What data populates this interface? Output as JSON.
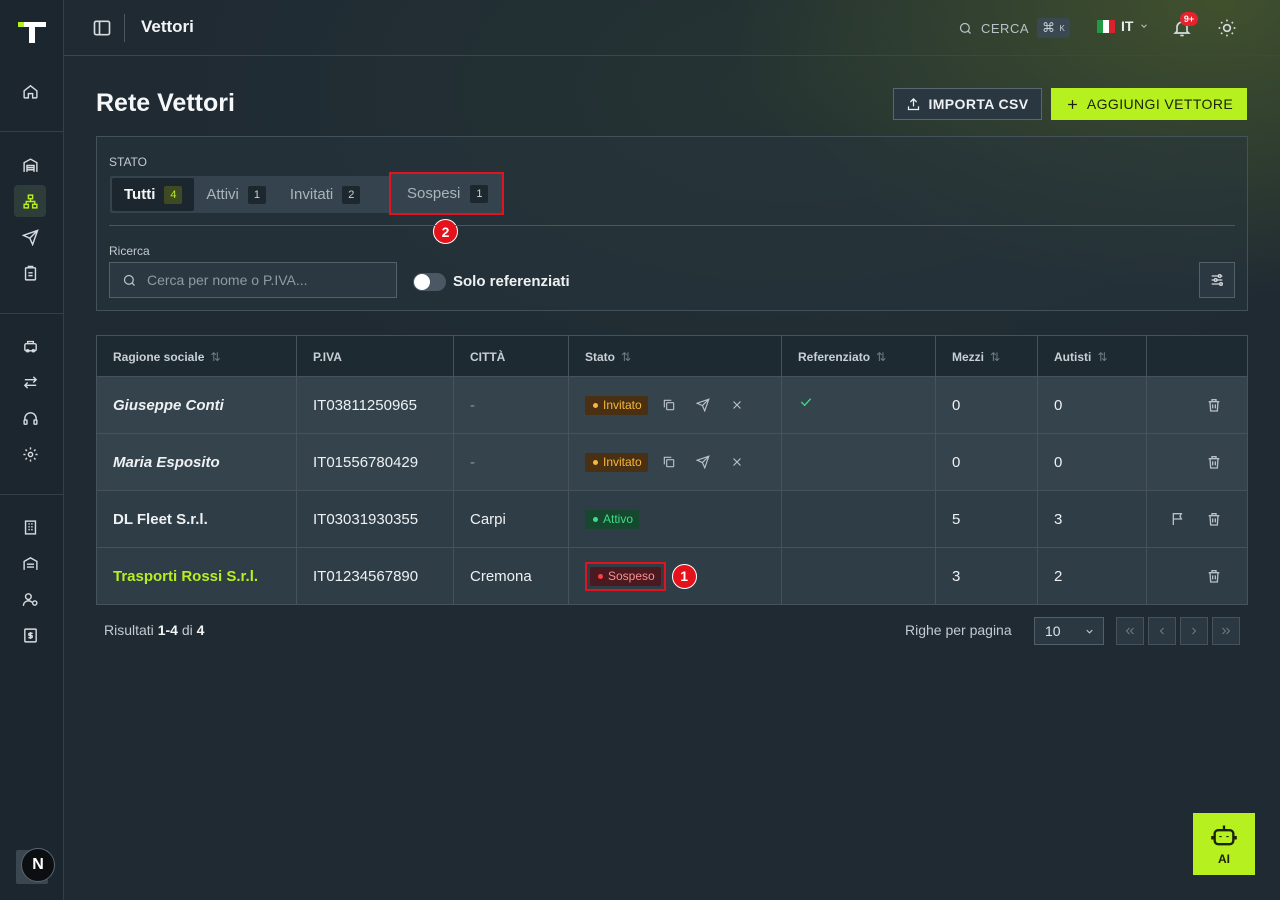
{
  "app": {
    "title": "Vettori"
  },
  "topbar": {
    "search_label": "CERCA",
    "shortcut_cmd": "⌘",
    "shortcut_key": "K",
    "language": "IT",
    "notifications_badge": "9+"
  },
  "page": {
    "title": "Rete Vettori",
    "import_label": "IMPORTA CSV",
    "add_label": "AGGIUNGI VETTORE"
  },
  "filters": {
    "status_label": "STATO",
    "tabs": [
      {
        "label": "Tutti",
        "count": "4",
        "active": true
      },
      {
        "label": "Attivi",
        "count": "1"
      },
      {
        "label": "Invitati",
        "count": "2"
      },
      {
        "label": "Sospesi",
        "count": "1"
      }
    ],
    "search_label": "Ricerca",
    "search_placeholder": "Cerca per nome o P.IVA...",
    "only_referenced_label": "Solo referenziati"
  },
  "annotations": {
    "marker_1": "1",
    "marker_2": "2"
  },
  "table": {
    "headers": [
      "Ragione sociale",
      "P.IVA",
      "CITTÀ",
      "Stato",
      "Referenziato",
      "Mezzi",
      "Autisti"
    ],
    "rows": [
      {
        "name": "Giuseppe Conti",
        "piva": "IT03811250965",
        "city": "-",
        "status": "Invitato",
        "referenced": true,
        "mezzi": "0",
        "autisti": "0"
      },
      {
        "name": "Maria Esposito",
        "piva": "IT01556780429",
        "city": "-",
        "status": "Invitato",
        "referenced": false,
        "mezzi": "0",
        "autisti": "0"
      },
      {
        "name": "DL Fleet S.r.l.",
        "piva": "IT03031930355",
        "city": "Carpi",
        "status": "Attivo",
        "referenced": false,
        "mezzi": "5",
        "autisti": "3"
      },
      {
        "name": "Trasporti Rossi S.r.l.",
        "piva": "IT01234567890",
        "city": "Cremona",
        "status": "Sospeso",
        "referenced": false,
        "mezzi": "3",
        "autisti": "2"
      }
    ]
  },
  "footer": {
    "results_prefix": "Risultati",
    "results_range": "1-4",
    "results_of": "di",
    "results_total": "4",
    "rows_per_page_label": "Righe per pagina",
    "rows_per_page_value": "10"
  },
  "ai_button": {
    "label": "AI"
  },
  "user": {
    "initial": "N"
  },
  "colors": {
    "accent": "#b6f01e",
    "invited": "#f6b73b",
    "active": "#3fdc84",
    "suspended": "#ff3d45"
  }
}
